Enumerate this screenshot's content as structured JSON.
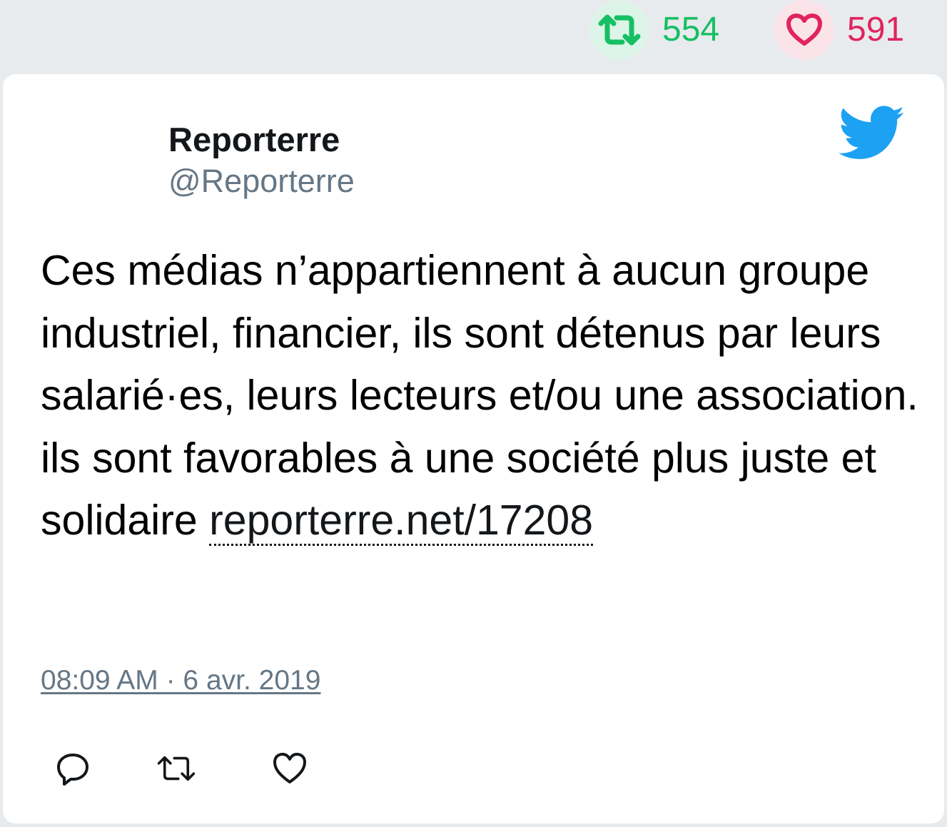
{
  "stats": {
    "retweets": "554",
    "likes": "591"
  },
  "author": {
    "name": "Reporterre",
    "handle": "@Reporterre"
  },
  "tweet": {
    "text": "Ces médias n’appartiennent à aucun groupe industriel, financier, ils sont détenus par leurs salarié·es, leurs lecteurs et/ou une association. ils sont favorables à une société plus juste et solidaire ",
    "link": "reporterre.net/17208",
    "timestamp": "08:09 AM · 6 avr. 2019"
  },
  "icons": {
    "retweet_stat": "retweet-icon",
    "like_stat": "heart-icon",
    "brand": "twitter-bird-icon",
    "reply_action": "reply-icon",
    "retweet_action": "retweet-icon",
    "like_action": "heart-icon"
  },
  "colors": {
    "retweet_green": "#17bf63",
    "like_red": "#e0245e",
    "twitter_blue": "#1da1f2",
    "muted_gray": "#657786"
  }
}
